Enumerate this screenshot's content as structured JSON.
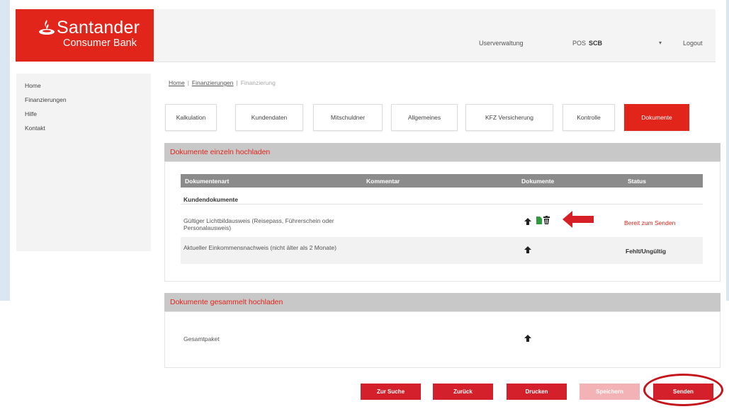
{
  "brand": {
    "name": "Santander",
    "subtitle": "Consumer Bank",
    "color": "#e1251b"
  },
  "header": {
    "user_admin": "Userverwaltung",
    "pos_label": "POS",
    "pos_value": "SCB",
    "logout": "Logout"
  },
  "sidebar": {
    "items": [
      {
        "label": "Home"
      },
      {
        "label": "Finanzierungen"
      },
      {
        "label": "Hilfe"
      },
      {
        "label": "Kontakt"
      }
    ]
  },
  "breadcrumb": {
    "items": [
      "Home",
      "Finanzierungen",
      "Finanzierung"
    ]
  },
  "tabs": [
    {
      "label": "Kalkulation"
    },
    {
      "label": "Kundendaten"
    },
    {
      "label": "Mitschuldner"
    },
    {
      "label": "Allgemeines"
    },
    {
      "label": "KFZ Versicherung"
    },
    {
      "label": "Kontrolle"
    },
    {
      "label": "Dokumente",
      "active": true
    }
  ],
  "single_upload": {
    "title": "Dokumente einzeln hochladen",
    "columns": [
      "Dokumentenart",
      "Kommentar",
      "Dokumente",
      "Status"
    ],
    "group": "Kundendokumente",
    "rows": [
      {
        "doc": "Gültiger Lichtbildausweis (Reisepass, Führerschein oder Personalausweis)",
        "status": "Bereit zum Senden"
      },
      {
        "doc": "Aktueller Einkommensnachweis (nicht älter als 2 Monate)",
        "status": "Fehlt/Ungültig"
      }
    ]
  },
  "bulk_upload": {
    "title": "Dokumente gesammelt hochladen",
    "row": {
      "doc": "Gesamtpaket"
    }
  },
  "footer_buttons": {
    "search": "Zur Suche",
    "back": "Zurück",
    "print": "Drucken",
    "save": "Speichern",
    "send": "Senden"
  },
  "annotation_color": "#c4151c"
}
